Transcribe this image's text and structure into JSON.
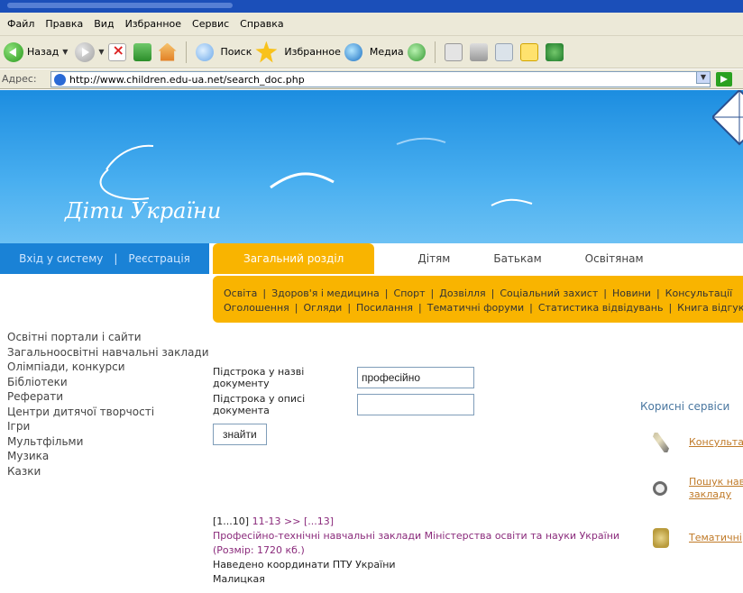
{
  "browser": {
    "menu": [
      "Файл",
      "Правка",
      "Вид",
      "Избранное",
      "Сервис",
      "Справка"
    ],
    "toolbar": {
      "back_label": "Назад",
      "search_label": "Поиск",
      "favorites_label": "Избранное",
      "media_label": "Медиа"
    },
    "address_label": "Адрес:",
    "address_url": "http://www.children.edu-ua.net/search_doc.php"
  },
  "site": {
    "logo_text": "Діти України",
    "login_label": "Вхід у систему",
    "separator": "|",
    "register_label": "Реєстрація",
    "tabs": [
      "Загальний розділ",
      "Дітям",
      "Батькам",
      "Освітянам"
    ],
    "subnav_row1": [
      "Освіта",
      "|",
      "Здоров'я і медицина",
      "|",
      "Спорт",
      "|",
      "Дозвілля",
      "|",
      "Соціальний захист",
      "|",
      "Новини",
      "|",
      "Консультації"
    ],
    "subnav_row2": [
      "Оголошення",
      "|",
      "Огляди",
      "|",
      "Посилання",
      "|",
      "Тематичні форуми",
      "|",
      "Статистика відвідувань",
      "|",
      "Книга відгуків"
    ],
    "sidebar": [
      "Освітні портали і сайти",
      "Загальноосвітні навчальні заклади",
      "Олімпіади, конкурси",
      "Бібліотеки",
      "Реферати",
      "Центри дитячої творчості",
      "Ігри",
      "Мультфільми",
      "Музика",
      "Казки"
    ],
    "form": {
      "title_label": "Підстрока у назві документу",
      "title_value": "професійно",
      "desc_label": "Підстрока у описі документа",
      "desc_value": "",
      "button": "знайти"
    },
    "results": {
      "pager_current": "[1...10]",
      "pager_next": "11-13 >>",
      "pager_last": "[...13]",
      "title": "Професійно-технічні навчальні заклади Міністерства освіти та науки України (Розмір: 1720 кб.)",
      "description": "Наведено координати ПТУ України",
      "author": "Малицкая"
    },
    "services": {
      "title": "Корисні сервіси",
      "items": [
        {
          "label": "Консульта",
          "icon": "pencil-icon"
        },
        {
          "label": "Пошук нав",
          "label2": "закладу",
          "icon": "magnifier-icon"
        },
        {
          "label": "Тематичні",
          "icon": "forum-icon"
        }
      ]
    }
  }
}
